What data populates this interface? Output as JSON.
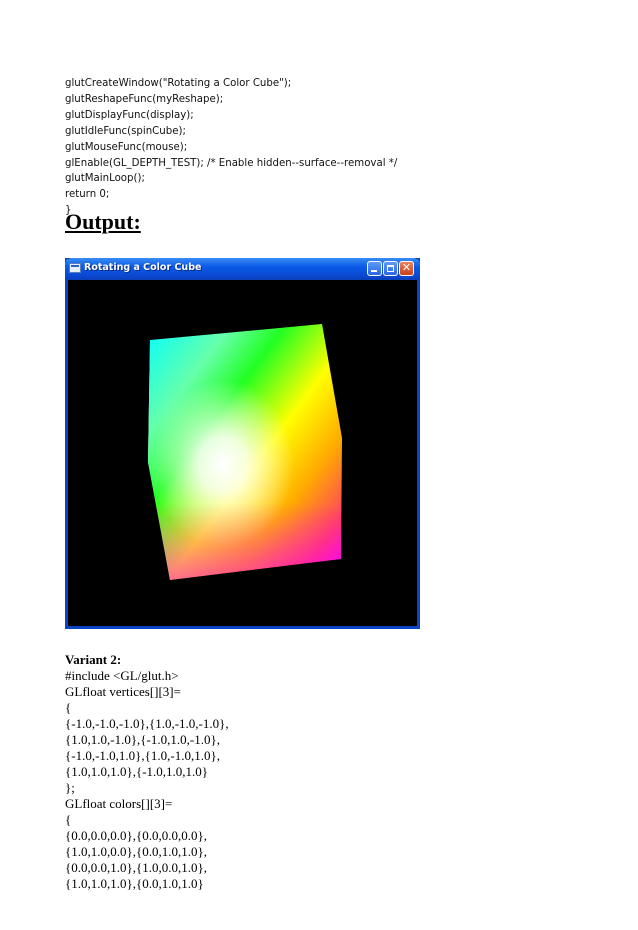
{
  "code_top": [
    "glutCreateWindow(\"Rotating a Color Cube\");",
    "glutReshapeFunc(myReshape);",
    "glutDisplayFunc(display);",
    "glutIdleFunc(spinCube);",
    "glutMouseFunc(mouse);",
    "glEnable(GL_DEPTH_TEST); /* Enable hidden--surface--removal */",
    "glutMainLoop();",
    "return 0;",
    "}"
  ],
  "output_heading": "Output:",
  "window": {
    "title": "Rotating a Color Cube",
    "close_glyph": "✕",
    "titlebar_color": "#0b49d2",
    "canvas_color": "#000000"
  },
  "variant_title": "Variant 2:",
  "code_bottom": [
    "#include <GL/glut.h>",
    "GLfloat vertices[][3]=",
    "{",
    "{-1.0,-1.0,-1.0},{1.0,-1.0,-1.0},",
    "{1.0,1.0,-1.0},{-1.0,1.0,-1.0},",
    "{-1.0,-1.0,1.0},{1.0,-1.0,1.0},",
    "{1.0,1.0,1.0},{-1.0,1.0,1.0}",
    "};",
    "GLfloat colors[][3]=",
    "{",
    "{0.0,0.0,0.0},{0.0,0.0,0.0},",
    "{1.0,1.0,0.0},{0.0,1.0,1.0},",
    "{0.0,0.0,1.0},{1.0,0.0,1.0},",
    "{1.0,1.0,1.0},{0.0,1.0,1.0}"
  ]
}
